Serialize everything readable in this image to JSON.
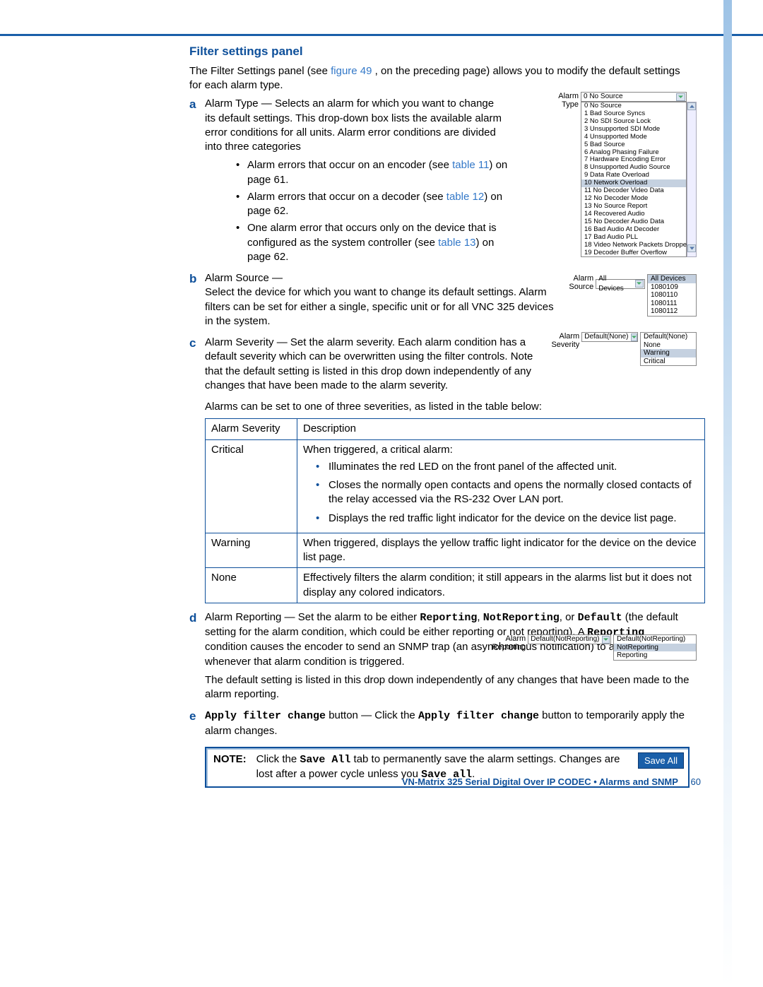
{
  "heading": "Filter settings panel",
  "intro_pre": "The Filter Settings panel (see ",
  "intro_link": "figure 49",
  "intro_post": ", on the preceding page) allows you to modify the default settings for each alarm type.",
  "a": {
    "letter": "a",
    "label": "Alarm Type",
    "dash": " — ",
    "body": "Selects an alarm for which you want to change its default settings. This drop-down box lists the available alarm error conditions for all units. Alarm error conditions are divided into three categories",
    "bullets": [
      {
        "pre": "Alarm errors that occur on an encoder (see ",
        "link": "table 11",
        "post": ") on page 61."
      },
      {
        "pre": "Alarm errors that occur on a decoder (see ",
        "link": "table 12",
        "post": ") on page 62."
      },
      {
        "pre": "One alarm error that occurs only on the device that is configured as the system controller (see ",
        "link": "table 13",
        "post": ") on page 62."
      }
    ]
  },
  "alarm_type_dd": {
    "label": "Alarm Type",
    "closed": "0 No Source",
    "options": [
      "0 No Source",
      "1 Bad Source Syncs",
      "2 No SDI Source Lock",
      "3 Unsupported SDI Mode",
      "4 Unsupported Mode",
      "5 Bad Source",
      "6 Analog Phasing Failure",
      "7 Hardware Encoding Error",
      "8 Unsupported Audio Source",
      "9 Data Rate Overload",
      "10 Network Overload",
      "11 No Decoder Video Data",
      "12 No Decoder Mode",
      "13 No Source Report",
      "14 Recovered Audio",
      "15 No Decoder Audio Data",
      "16 Bad Audio At Decoder",
      "17 Bad Audio PLL",
      "18 Video Network Packets Dropped",
      "19 Decoder Buffer Overflow"
    ],
    "selected_index": 10
  },
  "b": {
    "letter": "b",
    "label": "Alarm Source",
    "dash": " —",
    "body": "Select the device for which you want to change its default settings. Alarm filters can be set for either a single, specific unit or for all VNC 325 devices in the system."
  },
  "alarm_source_dd": {
    "label": "Alarm Source",
    "closed": "All Devices",
    "options": [
      "All Devices",
      "1080109",
      "1080110",
      "1080111",
      "1080112"
    ],
    "selected_index": 0
  },
  "c": {
    "letter": "c",
    "label": "Alarm Severity",
    "dash": " — ",
    "body": "Set the alarm severity. Each alarm condition has a default severity which can be overwritten using the filter controls. Note that the default setting is listed in this drop down independently of any changes that have been made to the alarm severity.",
    "after": "Alarms can be set to one of three severities, as listed in the table below:"
  },
  "alarm_severity_dd": {
    "label": "Alarm Severity",
    "closed": "Default(None)",
    "options": [
      "Default(None)",
      "None",
      "Warning",
      "Critical"
    ],
    "selected_index": 2
  },
  "sev_table": {
    "headers": [
      "Alarm Severity",
      "Description"
    ],
    "rows": [
      {
        "name": "Critical",
        "intro": "When triggered, a critical alarm:",
        "bullets": [
          "Illuminates the red LED on the front panel of the affected unit.",
          "Closes the normally open contacts and opens the normally closed contacts of the relay accessed via the RS-232 Over LAN port.",
          "Displays the red traffic light indicator for the device on the device list page."
        ]
      },
      {
        "name": "Warning",
        "intro": "When triggered, displays the yellow traffic light indicator for the device on the device list page."
      },
      {
        "name": "None",
        "intro": "Effectively filters the alarm condition; it still appears in the alarms list but it does not display any colored indicators."
      }
    ]
  },
  "d": {
    "letter": "d",
    "label": "Alarm Reporting",
    "dash": " — ",
    "body1": "Set the alarm to be either ",
    "m1": "Reporting",
    "body2": ", ",
    "m2": "NotReporting",
    "body3": ", or ",
    "m3": "Default",
    "body4": " (the default setting for the alarm condition, which could be either reporting or not reporting). A ",
    "m4": "Reporting",
    "body5": " condition causes the encoder to send an SNMP trap (an asynchronous notification) to an SNMP client whenever that alarm condition is triggered.",
    "after": "The default setting is listed in this drop down independently of any changes that have been made to the alarm reporting."
  },
  "alarm_reporting_dd": {
    "label": "Alarm Reporting",
    "closed": "Default(NotReporting)",
    "options": [
      "Default(NotReporting)",
      "NotReporting",
      "Reporting"
    ],
    "selected_index": 1
  },
  "e": {
    "letter": "e",
    "m1": "Apply filter change",
    "mid": " button — Click the ",
    "m2": "Apply filter change",
    "post": " button to temporarily apply the alarm changes."
  },
  "note": {
    "label": "NOTE:",
    "t1": "Click the ",
    "m1": "Save All",
    "t2": " tab to permanently save the alarm settings. Changes are lost after a power cycle unless you ",
    "m2": "Save all",
    "t3": ".",
    "button": "Save All"
  },
  "footer": {
    "title": "VN-Matrix 325 Serial Digital Over IP CODEC • Alarms and SNMP",
    "page": "60"
  }
}
